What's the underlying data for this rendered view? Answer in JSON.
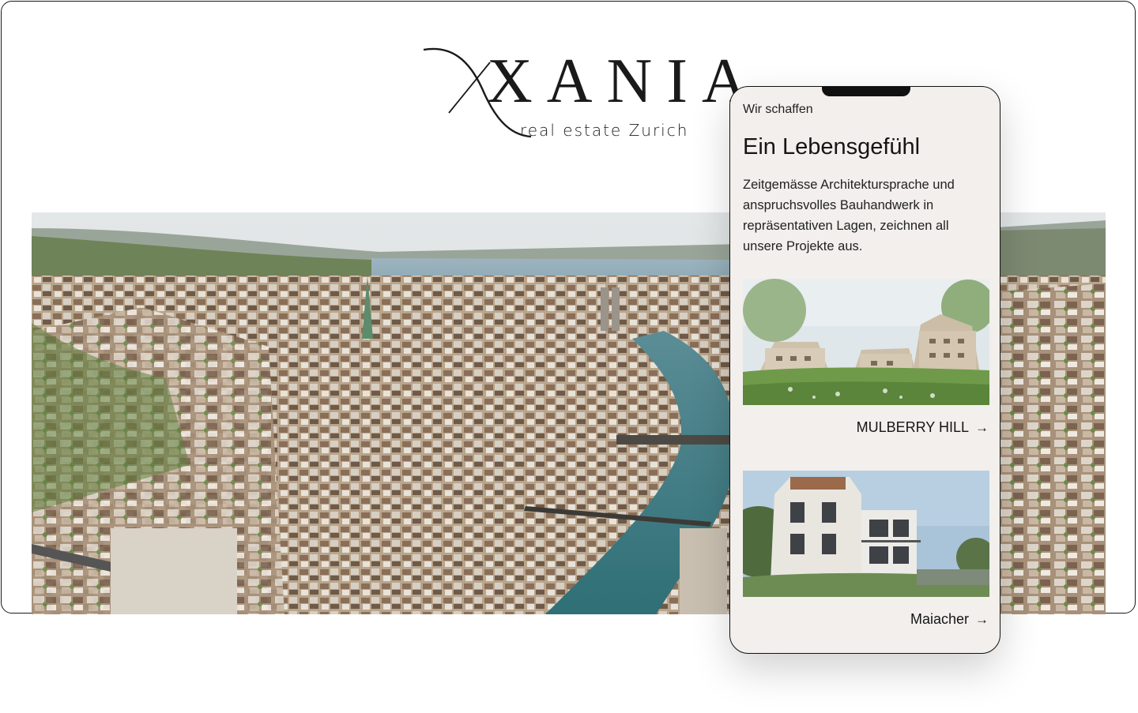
{
  "logo": {
    "wordmark": "XANIA",
    "tagline": "real estate Zurich"
  },
  "hero": {
    "image": "zurich-aerial-river-view"
  },
  "phone": {
    "eyebrow": "Wir schaffen",
    "headline": "Ein Lebensgefühl",
    "intro": "Zeitgemässe Architektursprache und anspruchsvolles Bauhandwerk in repräsentativen Lagen, zeichnen all unsere Projekte aus.",
    "projects": [
      {
        "name": "MULBERRY HILL",
        "arrow": "→",
        "image": "mulberry-hill-rendering"
      },
      {
        "name": "Maiacher",
        "arrow": "→",
        "image": "maiacher-rendering"
      }
    ]
  },
  "colors": {
    "text": "#1a1a1a",
    "phone_bg": "#f2efec",
    "river": "#3f7f86",
    "lake": "#8aa9b8"
  }
}
